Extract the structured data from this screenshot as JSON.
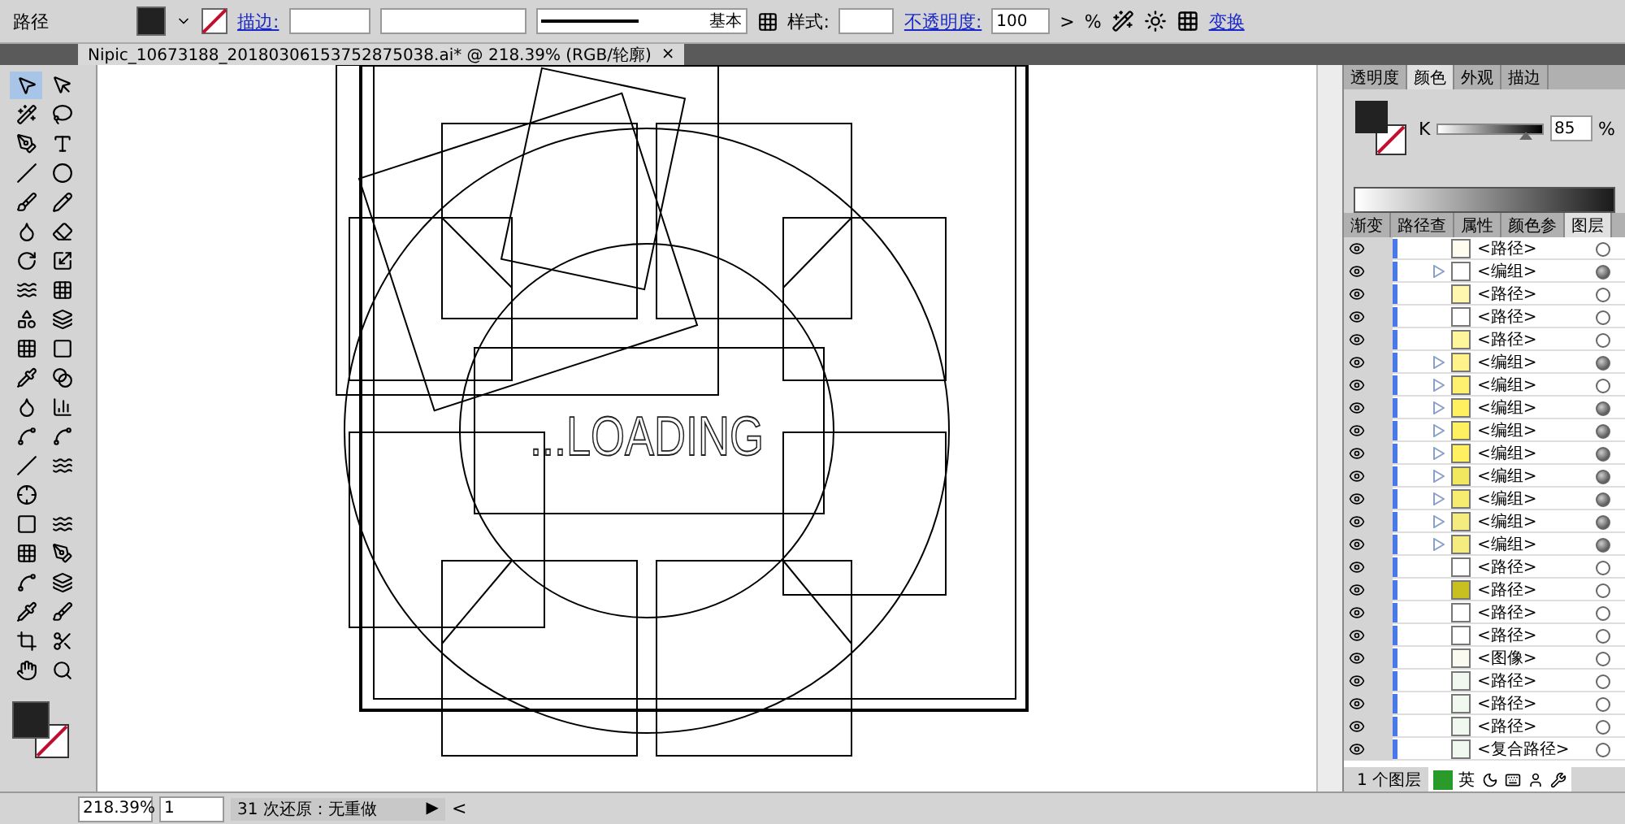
{
  "control_bar": {
    "selection": "路径",
    "stroke_label": "描边:",
    "profile": "基本",
    "style_label": "样式:",
    "opacity_label": "不透明度:",
    "opacity": "100",
    "opacity_arrow": ">",
    "percent": "%",
    "transform": "变换"
  },
  "document_tab": {
    "title": "Nipic_10673188_20180306153752875038.ai* @ 218.39% (RGB/轮廓)",
    "close": "×"
  },
  "artwork": {
    "text": "...LOADING"
  },
  "color_panel": {
    "tabs": [
      {
        "label": "透明度",
        "selected": false
      },
      {
        "label": "颜色",
        "selected": true
      },
      {
        "label": "外观",
        "selected": false
      },
      {
        "label": "描边",
        "selected": false
      }
    ],
    "channel": "K",
    "level": 0.85,
    "value": "85",
    "unit": "%"
  },
  "layers_panel": {
    "tabs": [
      {
        "label": "渐变",
        "selected": false
      },
      {
        "label": "路径查",
        "selected": false
      },
      {
        "label": "属性",
        "selected": false
      },
      {
        "label": "颜色参",
        "selected": false
      },
      {
        "label": "图层",
        "selected": true
      }
    ],
    "rows": [
      {
        "name": "<路径>",
        "expandable": false,
        "appearance": false,
        "color": "#fffdf0"
      },
      {
        "name": "<编组>",
        "expandable": true,
        "appearance": true,
        "color": "#ffffff"
      },
      {
        "name": "<路径>",
        "expandable": false,
        "appearance": false,
        "color": "#fff7b0"
      },
      {
        "name": "<路径>",
        "expandable": false,
        "appearance": false,
        "color": "#ffffff"
      },
      {
        "name": "<路径>",
        "expandable": false,
        "appearance": false,
        "color": "#fff59a"
      },
      {
        "name": "<编组>",
        "expandable": true,
        "appearance": true,
        "color": "#fff38a"
      },
      {
        "name": "<编组>",
        "expandable": true,
        "appearance": false,
        "color": "#fff170"
      },
      {
        "name": "<编组>",
        "expandable": true,
        "appearance": true,
        "color": "#fff060"
      },
      {
        "name": "<编组>",
        "expandable": true,
        "appearance": true,
        "color": "#fff060"
      },
      {
        "name": "<编组>",
        "expandable": true,
        "appearance": true,
        "color": "#fff060"
      },
      {
        "name": "<编组>",
        "expandable": true,
        "appearance": true,
        "color": "#f2e860"
      },
      {
        "name": "<编组>",
        "expandable": true,
        "appearance": true,
        "color": "#f5ec70"
      },
      {
        "name": "<编组>",
        "expandable": true,
        "appearance": true,
        "color": "#f5ec80"
      },
      {
        "name": "<编组>",
        "expandable": true,
        "appearance": true,
        "color": "#f5ec80"
      },
      {
        "name": "<路径>",
        "expandable": false,
        "appearance": false,
        "color": "#ffffff"
      },
      {
        "name": "<路径>",
        "expandable": false,
        "appearance": false,
        "color": "#c8c020"
      },
      {
        "name": "<路径>",
        "expandable": false,
        "appearance": false,
        "color": "#ffffff"
      },
      {
        "name": "<路径>",
        "expandable": false,
        "appearance": false,
        "color": "#ffffff"
      },
      {
        "name": "<图像>",
        "expandable": false,
        "appearance": false,
        "color": "#fafaf0"
      },
      {
        "name": "<路径>",
        "expandable": false,
        "appearance": false,
        "color": "#f0f8f0"
      },
      {
        "name": "<路径>",
        "expandable": false,
        "appearance": false,
        "color": "#f0f8f0"
      },
      {
        "name": "<路径>",
        "expandable": false,
        "appearance": false,
        "color": "#f0f8f0"
      },
      {
        "name": "<复合路径>",
        "expandable": false,
        "appearance": false,
        "color": "#f0f8f0"
      }
    ],
    "footer": "1 个图层"
  },
  "status_bar": {
    "zoom": "218.39%",
    "artboard": "1",
    "history": "31 次还原：无重做",
    "play": "▶",
    "back": "<"
  },
  "ime_bar": {
    "language": "英"
  }
}
